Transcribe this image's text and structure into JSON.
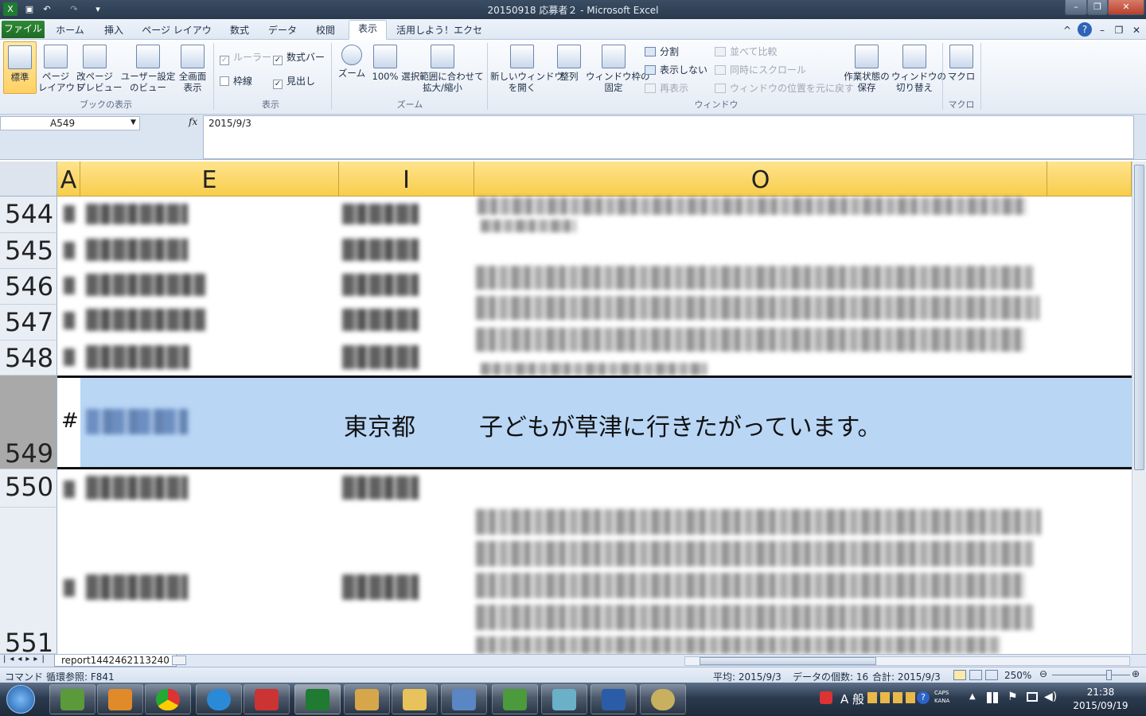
{
  "window": {
    "title": "20150918 応募者２ - Microsoft Excel"
  },
  "tabs": [
    "ファイル",
    "ホーム",
    "挿入",
    "ページ レイアウト",
    "数式",
    "データ",
    "校閲",
    "表示",
    "活用しよう！エクセル"
  ],
  "ribbon": {
    "workbook_views": {
      "normal": "標準",
      "page_layout": "ページ\nレイアウト",
      "page_break": "改ページ\nプレビュー",
      "custom_views": "ユーザー設定\nのビュー",
      "full_screen": "全画面\n表示",
      "label": "ブックの表示"
    },
    "show": {
      "ruler": "ルーラー",
      "formula_bar": "数式バー",
      "gridlines": "枠線",
      "headings": "見出し",
      "label": "表示"
    },
    "zoom": {
      "zoom": "ズーム",
      "hundred": "100%",
      "to_selection": "選択範囲に合わせて\n拡大/縮小",
      "label": "ズーム"
    },
    "window": {
      "new_window": "新しいウィンドウ\nを開く",
      "arrange": "整列",
      "freeze": "ウィンドウ枠の\n固定",
      "split": "分割",
      "hide": "表示しない",
      "unhide": "再表示",
      "side_by_side": "並べて比較",
      "sync_scroll": "同時にスクロール",
      "reset_pos": "ウィンドウの位置を元に戻す",
      "save_ws": "作業状態の\n保存",
      "switch": "ウィンドウの\n切り替え",
      "label": "ウィンドウ"
    },
    "macros": {
      "macro": "マクロ",
      "label": "マクロ"
    }
  },
  "formula": {
    "name_box": "A549",
    "fx": "fx",
    "value": "2015/9/3"
  },
  "columns": [
    "A",
    "E",
    "I",
    "O"
  ],
  "rows": [
    "544",
    "545",
    "546",
    "547",
    "548",
    "549",
    "550",
    "551"
  ],
  "selected_row": {
    "a": "#",
    "i": "東京都",
    "o": "子どもが草津に行きたがっています。"
  },
  "sheet": {
    "name": "report1442462113240"
  },
  "status": {
    "mode": "コマンド",
    "circular": "循環参照: F841",
    "average": "平均: 2015/9/3",
    "count": "データの個数: 16",
    "sum": "合計: 2015/9/3",
    "zoom": "250%"
  },
  "taskbar": {
    "time": "21:38",
    "date": "2015/09/19",
    "ime": "A 般",
    "caps": "CAPS",
    "kana": "KANA"
  },
  "colors": {
    "selection": "#b9d6f5",
    "header": "#f7cd4b",
    "file_tab": "#2f8a35"
  }
}
